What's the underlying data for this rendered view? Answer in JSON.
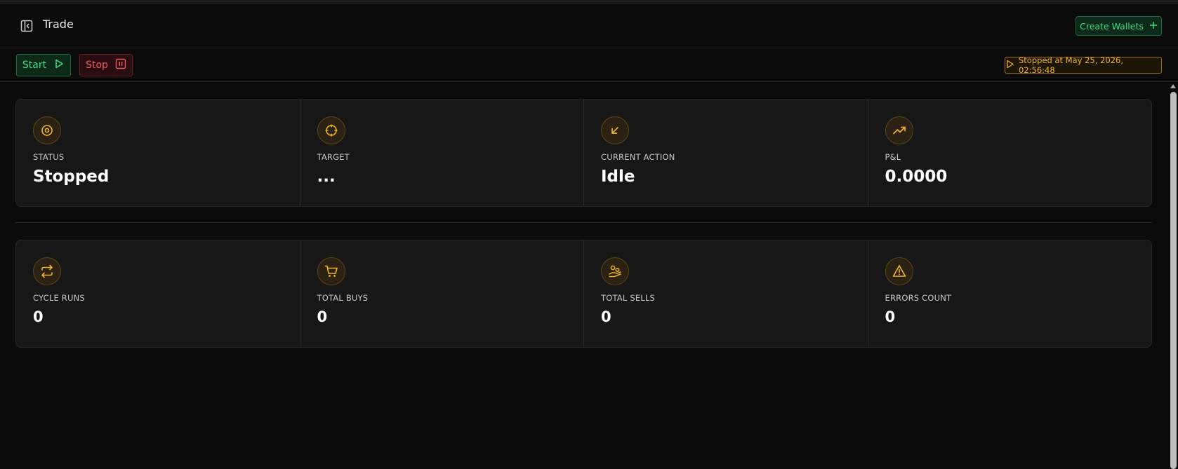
{
  "header": {
    "title": "Trade",
    "create_wallets_label": "Create Wallets",
    "sidebar_toggle_icon": "sidebar-collapse-icon"
  },
  "toolbar": {
    "start_label": "Start",
    "stop_label": "Stop",
    "status_text": "Stopped at May 25, 2026, 02:56:48"
  },
  "colors": {
    "green": "#3ddc84",
    "red": "#f05a5f",
    "amber": "#f0b429",
    "background": "#0b0b0b",
    "card": "#171717"
  },
  "stats_primary": [
    {
      "icon": "status-icon",
      "label": "STATUS",
      "value": "Stopped"
    },
    {
      "icon": "crosshair-icon",
      "label": "TARGET",
      "value": "..."
    },
    {
      "icon": "arrow-down-left-icon",
      "label": "CURRENT ACTION",
      "value": "Idle"
    },
    {
      "icon": "trending-up-icon",
      "label": "P&L",
      "value": "0.0000"
    }
  ],
  "stats_secondary": [
    {
      "icon": "repeat-icon",
      "label": "CYCLE RUNS",
      "value": "0"
    },
    {
      "icon": "cart-icon",
      "label": "TOTAL BUYS",
      "value": "0"
    },
    {
      "icon": "hand-coins-icon",
      "label": "TOTAL SELLS",
      "value": "0"
    },
    {
      "icon": "warning-icon",
      "label": "ERRORS COUNT",
      "value": "0"
    }
  ]
}
